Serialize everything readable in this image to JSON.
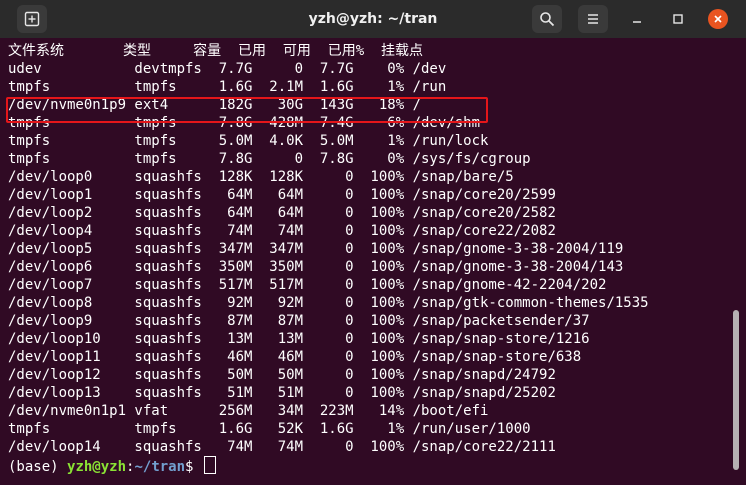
{
  "window": {
    "title": "yzh@yzh: ~/tran"
  },
  "icons": {
    "new_tab": "new-tab-icon",
    "search": "search-icon",
    "menu": "hamburger-menu-icon",
    "minimize": "minimize-icon",
    "maximize": "maximize-icon",
    "close": "close-icon"
  },
  "colors": {
    "terminal_bg": "#300a24",
    "highlight_box": "#e5161a",
    "prompt_user": "#8ae234",
    "prompt_path": "#729fcf",
    "close_button": "#e95420"
  },
  "header": [
    "文件系统",
    "类型",
    "容量",
    "已用",
    "可用",
    "已用%",
    "挂载点"
  ],
  "rows": [
    [
      "udev",
      "devtmpfs",
      "7.7G",
      "0",
      "7.7G",
      "0%",
      "/dev"
    ],
    [
      "tmpfs",
      "tmpfs",
      "1.6G",
      "2.1M",
      "1.6G",
      "1%",
      "/run"
    ],
    [
      "/dev/nvme0n1p9",
      "ext4",
      "182G",
      "30G",
      "143G",
      "18%",
      "/"
    ],
    [
      "tmpfs",
      "tmpfs",
      "7.8G",
      "428M",
      "7.4G",
      "6%",
      "/dev/shm"
    ],
    [
      "tmpfs",
      "tmpfs",
      "5.0M",
      "4.0K",
      "5.0M",
      "1%",
      "/run/lock"
    ],
    [
      "tmpfs",
      "tmpfs",
      "7.8G",
      "0",
      "7.8G",
      "0%",
      "/sys/fs/cgroup"
    ],
    [
      "/dev/loop0",
      "squashfs",
      "128K",
      "128K",
      "0",
      "100%",
      "/snap/bare/5"
    ],
    [
      "/dev/loop1",
      "squashfs",
      "64M",
      "64M",
      "0",
      "100%",
      "/snap/core20/2599"
    ],
    [
      "/dev/loop2",
      "squashfs",
      "64M",
      "64M",
      "0",
      "100%",
      "/snap/core20/2582"
    ],
    [
      "/dev/loop4",
      "squashfs",
      "74M",
      "74M",
      "0",
      "100%",
      "/snap/core22/2082"
    ],
    [
      "/dev/loop5",
      "squashfs",
      "347M",
      "347M",
      "0",
      "100%",
      "/snap/gnome-3-38-2004/119"
    ],
    [
      "/dev/loop6",
      "squashfs",
      "350M",
      "350M",
      "0",
      "100%",
      "/snap/gnome-3-38-2004/143"
    ],
    [
      "/dev/loop7",
      "squashfs",
      "517M",
      "517M",
      "0",
      "100%",
      "/snap/gnome-42-2204/202"
    ],
    [
      "/dev/loop8",
      "squashfs",
      "92M",
      "92M",
      "0",
      "100%",
      "/snap/gtk-common-themes/1535"
    ],
    [
      "/dev/loop9",
      "squashfs",
      "87M",
      "87M",
      "0",
      "100%",
      "/snap/packetsender/37"
    ],
    [
      "/dev/loop10",
      "squashfs",
      "13M",
      "13M",
      "0",
      "100%",
      "/snap/snap-store/1216"
    ],
    [
      "/dev/loop11",
      "squashfs",
      "46M",
      "46M",
      "0",
      "100%",
      "/snap/snap-store/638"
    ],
    [
      "/dev/loop12",
      "squashfs",
      "50M",
      "50M",
      "0",
      "100%",
      "/snap/snapd/24792"
    ],
    [
      "/dev/loop13",
      "squashfs",
      "51M",
      "51M",
      "0",
      "100%",
      "/snap/snapd/25202"
    ],
    [
      "/dev/nvme0n1p1",
      "vfat",
      "256M",
      "34M",
      "223M",
      "14%",
      "/boot/efi"
    ],
    [
      "tmpfs",
      "tmpfs",
      "1.6G",
      "52K",
      "1.6G",
      "1%",
      "/run/user/1000"
    ],
    [
      "/dev/loop14",
      "squashfs",
      "74M",
      "74M",
      "0",
      "100%",
      "/snap/core22/2111"
    ]
  ],
  "prompt": {
    "env": "(base) ",
    "user": "yzh@yzh",
    "sep": ":",
    "path": "~/tran",
    "symbol": "$ "
  },
  "highlighted_row": "/dev/nvme0n1p9"
}
